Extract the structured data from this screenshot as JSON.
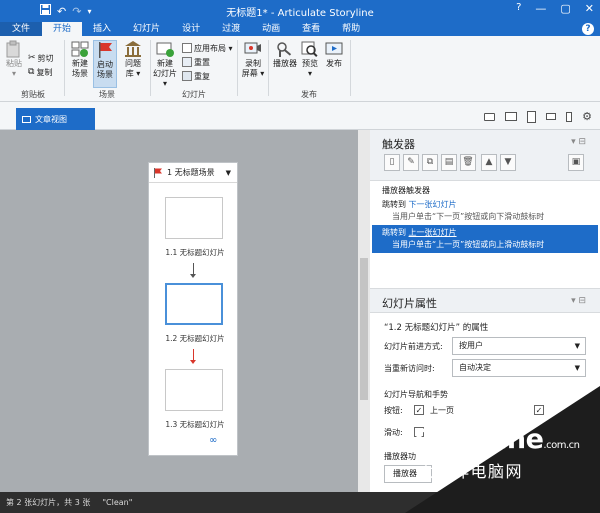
{
  "window": {
    "title": "无标题1* - Articulate Storyline",
    "controls": {
      "help": "?",
      "minimize": "—",
      "maximize": "▢",
      "close": "✕"
    }
  },
  "quick_access": {
    "save": "save-icon",
    "undo": "undo-icon",
    "redo": "redo-icon",
    "customize": "▾"
  },
  "tabs": [
    {
      "label": "文件"
    },
    {
      "label": "开始",
      "active": true
    },
    {
      "label": "插入"
    },
    {
      "label": "幻灯片"
    },
    {
      "label": "设计"
    },
    {
      "label": "过渡"
    },
    {
      "label": "动画"
    },
    {
      "label": "查看"
    },
    {
      "label": "帮助"
    }
  ],
  "ribbon": {
    "clipboard": {
      "group": "剪贴板",
      "paste": [
        "粘贴",
        "▾"
      ],
      "cut": "剪切",
      "copy": "复制"
    },
    "scenes": {
      "group": "场景",
      "new_scene": [
        "新建",
        "场景"
      ],
      "start_scene": [
        "启动",
        "场景"
      ],
      "question_bank": [
        "问题",
        "库 ▾"
      ]
    },
    "slides": {
      "group": "幻灯片",
      "new_slide": [
        "新建",
        "幻灯片 ▾"
      ],
      "apply_layout": "应用布局 ▾",
      "reset": "重置",
      "duplicate": "重复"
    },
    "record": {
      "label": [
        "录制",
        "屏幕 ▾"
      ]
    },
    "publish": {
      "group": "发布",
      "player": "播放器",
      "preview": [
        "预览",
        "▾"
      ],
      "publish": "发布"
    }
  },
  "story_view": {
    "tab": "文章视图"
  },
  "scene": {
    "title": "1 无标题场景",
    "slides": [
      {
        "label": "1.1 无标题幻灯片"
      },
      {
        "label": "1.2 无标题幻灯片"
      },
      {
        "label": "1.3 无标题幻灯片"
      }
    ]
  },
  "triggers_panel": {
    "title": "触发器",
    "group_label": "播放器触发器",
    "items": [
      {
        "action": "跳转到",
        "target": "下一张幻灯片",
        "condition": "当用户单击“下一页”按钮或向下滑动鼓标时"
      },
      {
        "action": "跳转到",
        "target": "上一张幻灯片",
        "condition": "当用户单击“上一页”按钮或向上滑动鼓标时"
      }
    ]
  },
  "slide_props": {
    "title": "幻灯片属性",
    "subtitle": "“1.2 无标题幻灯片” 的属性",
    "advance_label": "幻灯片前进方式:",
    "advance_value": "按用户",
    "revisit_label": "当重新访问时:",
    "revisit_value": "自动决定",
    "nav_label": "幻灯片导航和手势",
    "buttons_label": "按钮:",
    "prev_checkbox": "上一页",
    "swipe_label": "滑动:",
    "player_features_label": "播放器功",
    "player_button": "播放器"
  },
  "status": {
    "slide_info": "第 2 张幻灯片，共 3 张",
    "theme": "\"Clean\""
  },
  "watermark": {
    "logo": "PConline",
    "suffix": ".com.cn",
    "subtitle": "太平洋电脑网"
  },
  "colors": {
    "accent": "#1e6cc8",
    "start_flag": "#d9362b"
  }
}
